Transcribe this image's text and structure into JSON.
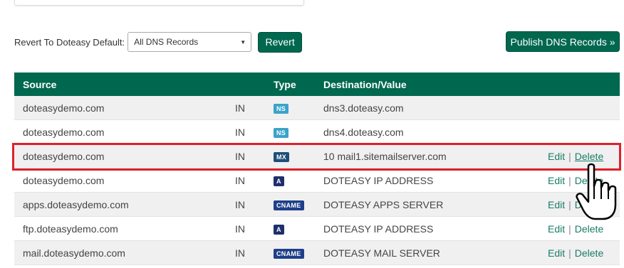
{
  "toolbar": {
    "revert_label": "Revert To Doteasy Default:",
    "select_value": "All DNS Records",
    "revert_button": "Revert",
    "publish_button": "Publish DNS Records »"
  },
  "table": {
    "headers": {
      "source": "Source",
      "in": "",
      "type": "Type",
      "destination": "Destination/Value",
      "actions": ""
    },
    "rows": [
      {
        "source": "doteasydemo.com",
        "in": "IN",
        "type": "NS",
        "destination": "dns3.doteasy.com",
        "edit": "",
        "sep": "",
        "delete": ""
      },
      {
        "source": "doteasydemo.com",
        "in": "IN",
        "type": "NS",
        "destination": "dns4.doteasy.com",
        "edit": "",
        "sep": "",
        "delete": ""
      },
      {
        "source": "doteasydemo.com",
        "in": "IN",
        "type": "MX",
        "destination": "10 mail1.sitemailserver.com",
        "edit": "Edit",
        "sep": "|",
        "delete": "Delete"
      },
      {
        "source": "doteasydemo.com",
        "in": "IN",
        "type": "A",
        "destination": "DOTEASY IP ADDRESS",
        "edit": "Edit",
        "sep": "|",
        "delete": "Delete"
      },
      {
        "source": "apps.doteasydemo.com",
        "in": "IN",
        "type": "CNAME",
        "destination": "DOTEASY APPS SERVER",
        "edit": "Edit",
        "sep": "|",
        "delete": "Delete"
      },
      {
        "source": "ftp.doteasydemo.com",
        "in": "IN",
        "type": "A",
        "destination": "DOTEASY IP ADDRESS",
        "edit": "Edit",
        "sep": "|",
        "delete": "Delete"
      },
      {
        "source": "mail.doteasydemo.com",
        "in": "IN",
        "type": "CNAME",
        "destination": "DOTEASY MAIL SERVER",
        "edit": "Edit",
        "sep": "|",
        "delete": "Delete"
      }
    ]
  },
  "colors": {
    "brand_green": "#00684f",
    "ns_badge": "#3aa3c9",
    "mx_badge": "#1d4f7a",
    "a_badge": "#1f2f6b",
    "cname_badge": "#1f3f8a",
    "highlight": "#e0202a",
    "link": "#1a7c68"
  },
  "icons": {
    "cursor": "hand-pointer-icon",
    "dropdown": "chevron-down-icon"
  }
}
